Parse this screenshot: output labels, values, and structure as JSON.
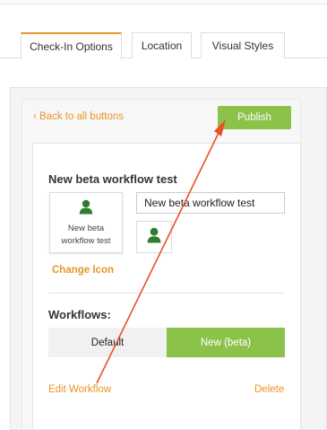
{
  "tabs": [
    {
      "label": "Check-In Options",
      "active": true
    },
    {
      "label": "Location",
      "active": false
    },
    {
      "label": "Visual Styles",
      "active": false
    }
  ],
  "editor": {
    "back_label": "Back to all buttons",
    "publish_label": "Publish",
    "button_title": "New beta workflow test",
    "preview_label": "New beta workflow test",
    "name_input_value": "New beta workflow test",
    "change_icon_label": "Change Icon",
    "workflows_label": "Workflows:",
    "workflow_options": [
      {
        "label": "Default",
        "selected": false
      },
      {
        "label": "New (beta)",
        "selected": true
      }
    ],
    "edit_workflow_label": "Edit Workflow",
    "delete_label": "Delete"
  },
  "icons": {
    "preview_icon": "person-icon",
    "selected_icon": "person-icon",
    "back_icon": "chevron-left-icon"
  },
  "colors": {
    "accent": "#e8962a",
    "primary": "#8bc34a",
    "icon": "#2e7d32",
    "annotation": "#e8502a"
  }
}
